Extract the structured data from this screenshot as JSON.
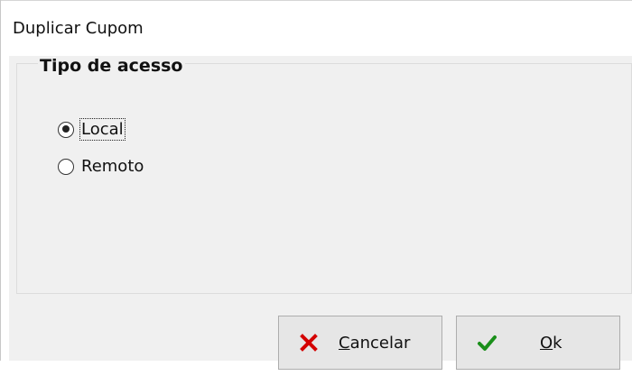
{
  "window": {
    "title": "Duplicar Cupom"
  },
  "group": {
    "title": "Tipo de acesso"
  },
  "radios": [
    {
      "label": "Local",
      "checked": true
    },
    {
      "label": "Remoto",
      "checked": false
    }
  ],
  "buttons": {
    "cancel": {
      "mnemonic": "C",
      "rest": "ancelar",
      "icon": "close-x-icon",
      "icon_color": "#d40000"
    },
    "ok": {
      "mnemonic": "O",
      "rest": "k",
      "icon": "checkmark-icon",
      "icon_color": "#1a8f1a"
    }
  }
}
